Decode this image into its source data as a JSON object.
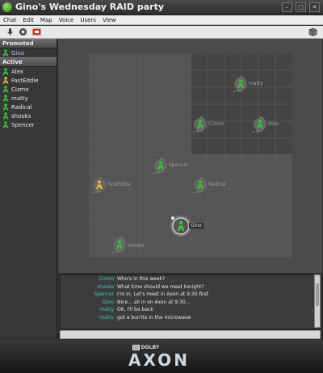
{
  "window": {
    "title": "Gino's Wednesday RAID party",
    "buttons": [
      "–",
      "□",
      "✕"
    ]
  },
  "menu": [
    "Chat",
    "Edit",
    "Map",
    "Voice",
    "Users",
    "View"
  ],
  "toolbar": {
    "icons": [
      "microphone-icon",
      "speaker-icon",
      "mute-icon"
    ],
    "right_icon": "box-icon"
  },
  "sidebar": {
    "promoted_label": "Promoted",
    "promoted": [
      {
        "name": "Gino",
        "color": "#38c238"
      }
    ],
    "active_label": "Active",
    "active": [
      {
        "name": "Alex",
        "color": "#38c238"
      },
      {
        "name": "FastEddie",
        "color": "#e7b830"
      },
      {
        "name": "Cizmo",
        "color": "#38c238"
      },
      {
        "name": "matty",
        "color": "#38c238"
      },
      {
        "name": "Radical",
        "color": "#38c238"
      },
      {
        "name": "shooks",
        "color": "#38c238"
      },
      {
        "name": "Spencer",
        "color": "#38c238"
      }
    ]
  },
  "map": {
    "avatars": [
      {
        "name": "matty",
        "color": "#38c238"
      },
      {
        "name": "Cizmo",
        "color": "#38c238"
      },
      {
        "name": "Alex",
        "color": "#38c238"
      },
      {
        "name": "Spencer",
        "color": "#38c238"
      },
      {
        "name": "FastEddie",
        "color": "#e7b830"
      },
      {
        "name": "Radical",
        "color": "#38c238"
      },
      {
        "name": "Gino",
        "color": "#38c238"
      },
      {
        "name": "shooks",
        "color": "#38c238"
      }
    ]
  },
  "chat": {
    "messages": [
      {
        "name": "Cizmo",
        "text": "Who's in this week?"
      },
      {
        "name": "shooks",
        "text": "What time should we meet tonight?"
      },
      {
        "name": "Spencer",
        "text": "I'm in.  Let's meet in Axon at 9:30 first"
      },
      {
        "name": "Gino",
        "text": "Nice... all in on Axon at 9:30..."
      },
      {
        "name": "matty",
        "text": "OK, I'll be back"
      },
      {
        "name": "matty",
        "text": "got a burrito in the microwave"
      }
    ],
    "input_value": ""
  },
  "footer": {
    "brand_mark": "DOLBY",
    "product": "AXON"
  },
  "colors": {
    "accent_cyan": "#39c4c4",
    "user_green": "#38c238",
    "user_yellow": "#e7b830"
  }
}
